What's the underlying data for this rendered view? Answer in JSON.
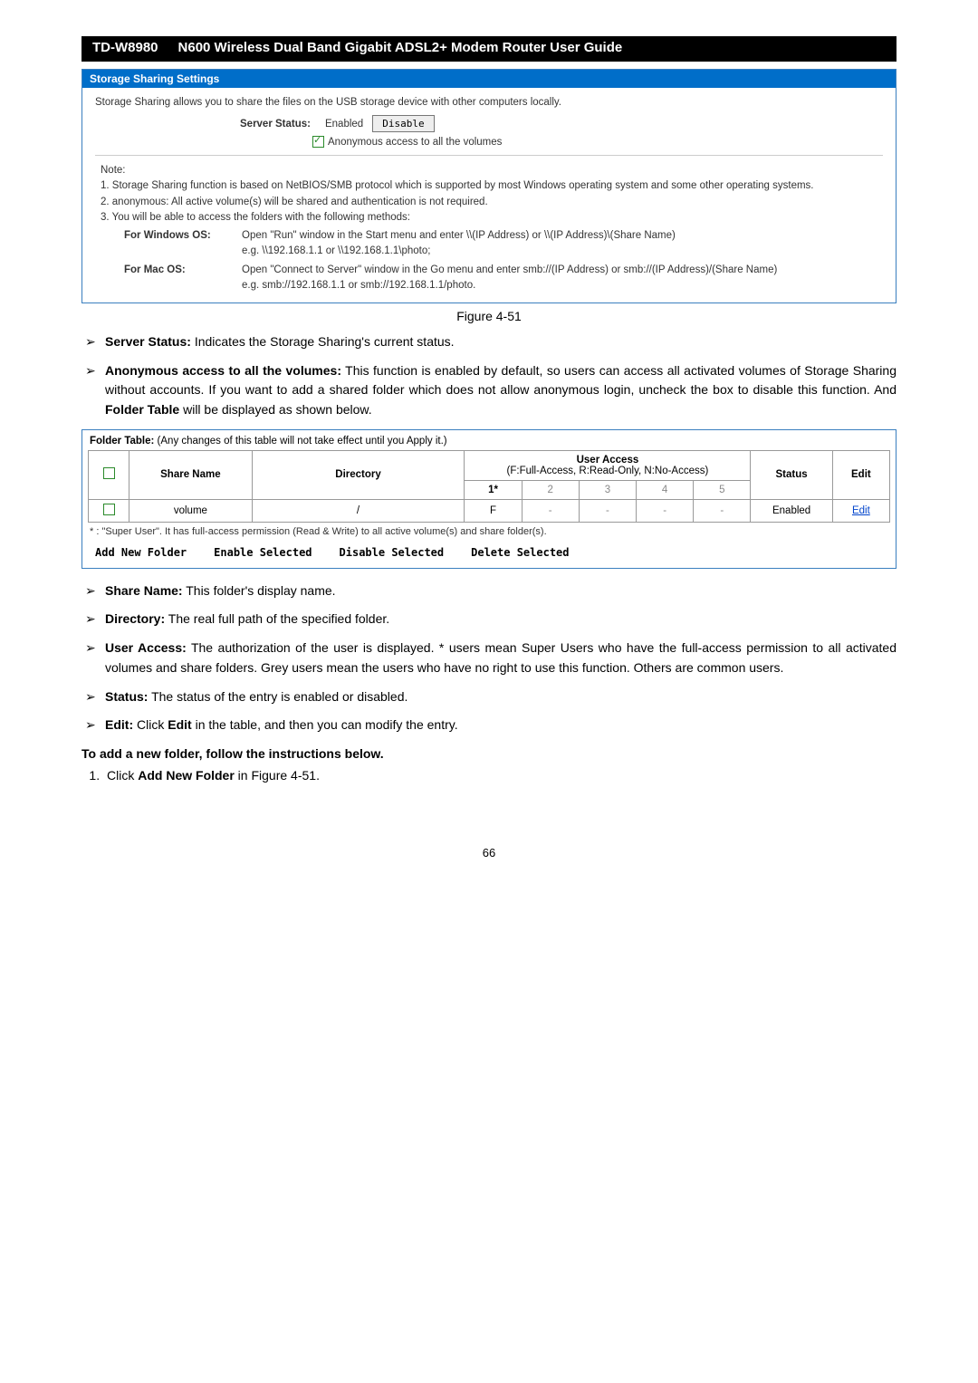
{
  "header": {
    "model": "TD-W8980",
    "title": "N600 Wireless Dual Band Gigabit ADSL2+ Modem Router User Guide"
  },
  "panel": {
    "heading": "Storage Sharing Settings",
    "intro": "Storage Sharing allows you to share the files on the USB storage device with other computers locally.",
    "server_status_label": "Server Status:",
    "enabled_text": "Enabled",
    "disable_btn": "Disable",
    "anon_label": "Anonymous access to all the volumes",
    "note_label": "Note:",
    "note1": "1. Storage Sharing function is based on NetBIOS/SMB protocol which is supported by most Windows operating system and some other operating systems.",
    "note2": "2. anonymous: All active volume(s) will be shared and authentication is not required.",
    "note3": "3. You will be able to access the folders with the following methods:",
    "win_label": "For Windows OS:",
    "win_text": "Open \"Run\" window in the Start menu and enter \\\\(IP Address) or \\\\(IP Address)\\(Share Name)\ne.g. \\\\192.168.1.1 or \\\\192.168.1.1\\photo;",
    "mac_label": "For Mac OS:",
    "mac_text": "Open \"Connect to Server\" window in the Go menu and enter smb://(IP Address) or smb://(IP Address)/(Share Name)\ne.g. smb://192.168.1.1 or smb://192.168.1.1/photo."
  },
  "figure_label": "Figure 4-51",
  "bullets1": {
    "b1_label": "Server Status:",
    "b1_text": " Indicates the Storage Sharing's current status.",
    "b2_label": "Anonymous access to all the volumes:",
    "b2_text": " This function is enabled by default, so users can access all activated volumes of Storage Sharing without accounts. If you want to add a shared folder which does not allow anonymous login, uncheck the box to disable this function. And ",
    "b2_label2": "Folder Table",
    "b2_text2": " will be displayed as shown below."
  },
  "folder_table": {
    "caption_leading": "Folder Table:",
    "caption_rest": " (Any changes of this table will not take effect until you Apply it.)",
    "headers": {
      "share": "Share Name",
      "dir": "Directory",
      "ua_title": "User Access",
      "ua_sub": "(F:Full-Access, R:Read-Only, N:No-Access)",
      "status": "Status",
      "edit": "Edit",
      "ua1": "1*",
      "ua2": "2",
      "ua3": "3",
      "ua4": "4",
      "ua5": "5"
    },
    "row": {
      "share": "volume",
      "dir": "/",
      "ua1": "F",
      "ua2": "-",
      "ua3": "-",
      "ua4": "-",
      "ua5": "-",
      "status": "Enabled",
      "edit": "Edit"
    },
    "footnote": "* : \"Super User\". It has full-access permission (Read & Write) to all active volume(s) and share folder(s).",
    "actions": {
      "add": "Add New Folder",
      "enable": "Enable Selected",
      "disable": "Disable Selected",
      "delete": "Delete Selected"
    }
  },
  "bullets2": {
    "b1_label": "Share Name:",
    "b1_text": " This folder's display name.",
    "b2_label": "Directory:",
    "b2_text": " The real full path of the specified folder.",
    "b3_label": "User Access:",
    "b3_text": " The authorization of the user is displayed. * users mean Super Users who have the full-access permission to all activated volumes and share folders. Grey users mean the users who have no right to use this function. Others are common users.",
    "b4_label": "Status:",
    "b4_text": " The status of the entry is enabled or disabled.",
    "b5_label": "Edit:",
    "b5_text_a": " Click ",
    "b5_label2": "Edit",
    "b5_text_b": " in the table, and then you can modify the entry."
  },
  "instructions": {
    "heading": "To add a new folder, follow the instructions below.",
    "step1_a": "Click ",
    "step1_bold": "Add New Folder",
    "step1_b": " in Figure 4-51."
  },
  "page_number": "66"
}
